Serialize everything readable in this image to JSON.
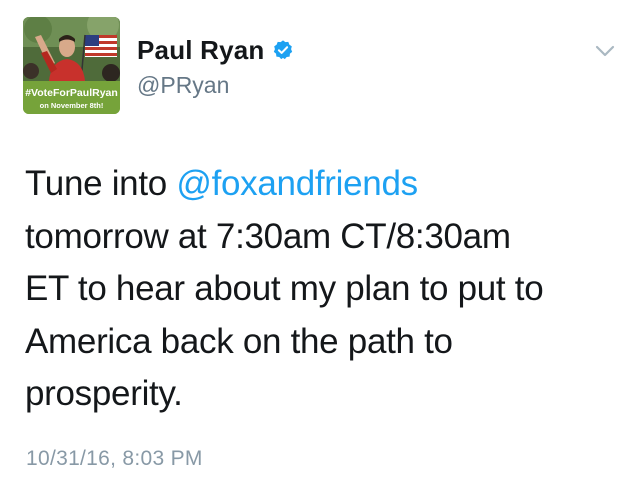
{
  "user": {
    "display_name": "Paul Ryan",
    "handle": "@PRyan",
    "verified": true,
    "avatar": {
      "banner_hashtag": "#VoteForPaulRyan",
      "banner_date": "on November 8th!"
    }
  },
  "tweet": {
    "text_line1_pre": "Tune into ",
    "mention": "@foxandfriends",
    "text_line2": "tomorrow at 7:30am CT/8:30am",
    "text_line3": "ET to hear about my plan to put to",
    "text_line4": "America back on the path to",
    "text_line5": "prosperity.",
    "timestamp": "10/31/16, 8:03 PM"
  },
  "colors": {
    "link_blue": "#1da1f2",
    "verified_blue": "#1da1f2",
    "secondary_gray": "#657786",
    "timestamp_gray": "#8899a6",
    "banner_green": "#76a33a"
  },
  "icons": {
    "verified": "verified-badge-icon",
    "more": "chevron-down-icon"
  }
}
